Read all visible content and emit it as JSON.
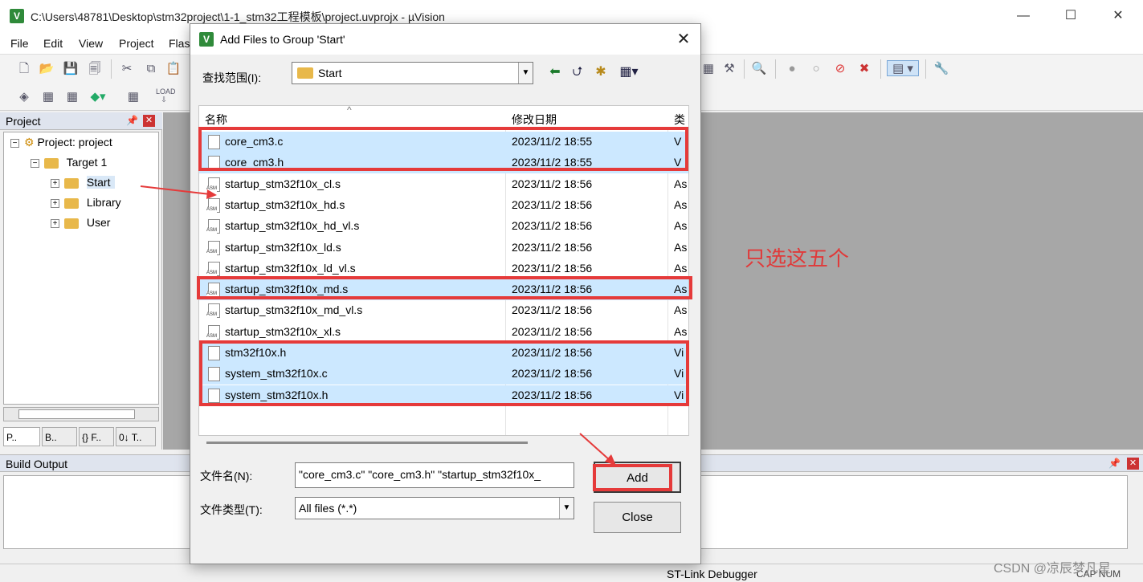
{
  "window": {
    "title": "C:\\Users\\48781\\Desktop\\stm32project\\1-1_stm32工程模板\\project.uvprojx - µVision",
    "app_icon": "V"
  },
  "menu": [
    "File",
    "Edit",
    "View",
    "Project",
    "Flas"
  ],
  "project_pane": {
    "title": "Project",
    "tree": {
      "root": "Project: project",
      "target": "Target 1",
      "groups": [
        "Start",
        "Library",
        "User"
      ]
    },
    "tabs": [
      "P..",
      "B..",
      "{} F..",
      "0↓ T.."
    ]
  },
  "build_output": {
    "title": "Build Output"
  },
  "status_bar": {
    "debugger": "ST-Link Debugger",
    "caps": "CAP NUM"
  },
  "annotation": {
    "text": "只选这五个"
  },
  "watermark": "CSDN @凉辰梦凡星",
  "dialog": {
    "title": "Add Files to Group 'Start'",
    "look_in_label": "查找范围(I):",
    "look_in_value": "Start",
    "columns": {
      "name": "名称",
      "date": "修改日期",
      "type": "类"
    },
    "files": [
      {
        "name": "core_cm3.c",
        "date": "2023/11/2 18:55",
        "type": "V",
        "icon": "doc-icon",
        "selected": true
      },
      {
        "name": "core_cm3.h",
        "date": "2023/11/2 18:55",
        "type": "V",
        "icon": "doc-icon",
        "selected": true
      },
      {
        "name": "startup_stm32f10x_cl.s",
        "date": "2023/11/2 18:56",
        "type": "As",
        "icon": "asm-file-icon",
        "selected": false
      },
      {
        "name": "startup_stm32f10x_hd.s",
        "date": "2023/11/2 18:56",
        "type": "As",
        "icon": "asm-file-icon",
        "selected": false
      },
      {
        "name": "startup_stm32f10x_hd_vl.s",
        "date": "2023/11/2 18:56",
        "type": "As",
        "icon": "asm-file-icon",
        "selected": false
      },
      {
        "name": "startup_stm32f10x_ld.s",
        "date": "2023/11/2 18:56",
        "type": "As",
        "icon": "asm-file-icon",
        "selected": false
      },
      {
        "name": "startup_stm32f10x_ld_vl.s",
        "date": "2023/11/2 18:56",
        "type": "As",
        "icon": "asm-file-icon",
        "selected": false
      },
      {
        "name": "startup_stm32f10x_md.s",
        "date": "2023/11/2 18:56",
        "type": "As",
        "icon": "asm-file-icon",
        "selected": true
      },
      {
        "name": "startup_stm32f10x_md_vl.s",
        "date": "2023/11/2 18:56",
        "type": "As",
        "icon": "asm-file-icon",
        "selected": false
      },
      {
        "name": "startup_stm32f10x_xl.s",
        "date": "2023/11/2 18:56",
        "type": "As",
        "icon": "asm-file-icon",
        "selected": false
      },
      {
        "name": "stm32f10x.h",
        "date": "2023/11/2 18:56",
        "type": "Vi",
        "icon": "doc-icon",
        "selected": true
      },
      {
        "name": "system_stm32f10x.c",
        "date": "2023/11/2 18:56",
        "type": "Vi",
        "icon": "doc-icon",
        "selected": true
      },
      {
        "name": "system_stm32f10x.h",
        "date": "2023/11/2 18:56",
        "type": "Vi",
        "icon": "doc-icon",
        "selected": true
      }
    ],
    "file_name_label": "文件名(N):",
    "file_name_value": "\"core_cm3.c\" \"core_cm3.h\" \"startup_stm32f10x_",
    "file_type_label": "文件类型(T):",
    "file_type_value": "All files (*.*)",
    "add_label": "Add",
    "close_label": "Close"
  },
  "colors": {
    "selection": "#cce8ff",
    "annotation_red": "#e53a3a",
    "editor_gray": "#a7a7a7",
    "dialog_bg": "#f0f0f0"
  }
}
